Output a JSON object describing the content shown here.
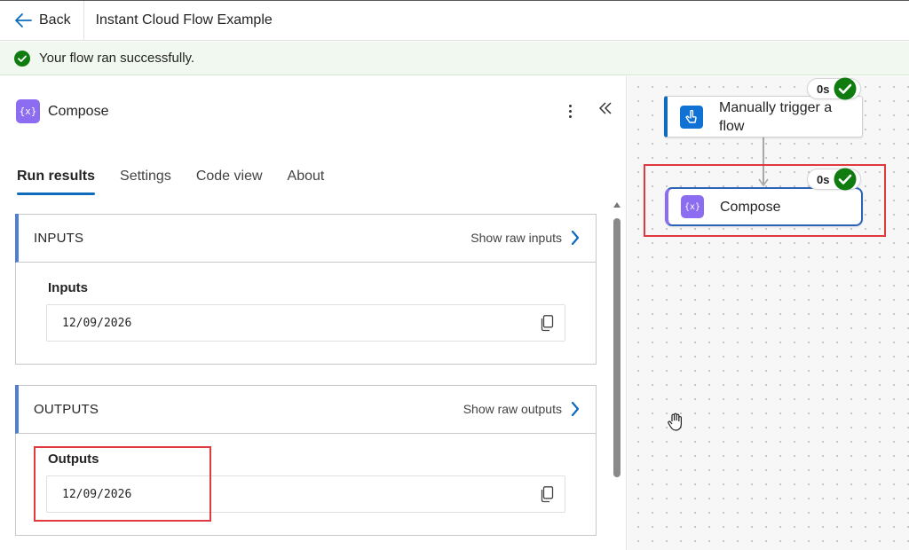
{
  "header": {
    "back_label": "Back",
    "flow_title": "Instant Cloud Flow Example"
  },
  "banner": {
    "message": "Your flow ran successfully.",
    "status_color": "#107c10"
  },
  "panel": {
    "title": "Compose",
    "badge_glyph": "{x}",
    "tabs": [
      {
        "label": "Run results",
        "active": true
      },
      {
        "label": "Settings",
        "active": false
      },
      {
        "label": "Code view",
        "active": false
      },
      {
        "label": "About",
        "active": false
      }
    ],
    "inputs": {
      "section_label": "INPUTS",
      "raw_link": "Show raw inputs",
      "field_label": "Inputs",
      "field_value": "12/09/2026"
    },
    "outputs": {
      "section_label": "OUTPUTS",
      "raw_link": "Show raw outputs",
      "field_label": "Outputs",
      "field_value": "12/09/2026"
    }
  },
  "canvas": {
    "nodes": [
      {
        "label": "Manually trigger a flow",
        "duration": "0s",
        "status": "succeeded",
        "icon": "touch-icon"
      },
      {
        "label": "Compose",
        "duration": "0s",
        "status": "succeeded",
        "icon": "compose-icon",
        "selected": true
      }
    ]
  },
  "colors": {
    "accent": "#0f6cbd",
    "compose": "#8c6cf0",
    "highlight": "#e0393e",
    "success": "#107c10"
  }
}
